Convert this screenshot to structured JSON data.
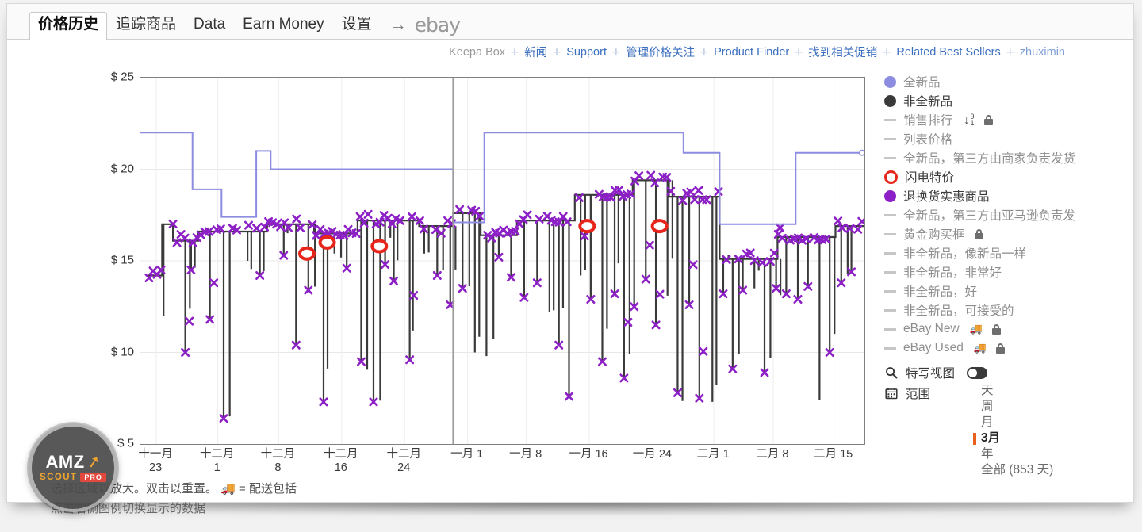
{
  "tabs": [
    {
      "label": "价格历史",
      "active": true
    },
    {
      "label": "追踪商品",
      "active": false
    },
    {
      "label": "Data",
      "active": false
    },
    {
      "label": "Earn Money",
      "active": false
    },
    {
      "label": "设置",
      "active": false
    }
  ],
  "header": {
    "arrow": "→",
    "ebay_logo": "ebay"
  },
  "navlinks": [
    {
      "label": "Keepa Box",
      "type": "static"
    },
    {
      "label": "新闻",
      "type": "link"
    },
    {
      "label": "Support",
      "type": "link"
    },
    {
      "label": "管理价格关注",
      "type": "link"
    },
    {
      "label": "Product Finder",
      "type": "link"
    },
    {
      "label": "找到相关促销",
      "type": "link"
    },
    {
      "label": "Related Best Sellers",
      "type": "link"
    },
    {
      "label": "zhuximin",
      "type": "muted"
    }
  ],
  "nav_separator": "✛",
  "legend": [
    {
      "label": "全新品",
      "marker": "dot",
      "color": "#8c8ce0",
      "active": false,
      "lock": false
    },
    {
      "label": "非全新品",
      "marker": "dot",
      "color": "#3a3a3a",
      "active": true,
      "lock": false
    },
    {
      "label": "销售排行",
      "marker": "dash",
      "color": "#c6c6c6",
      "active": false,
      "lock": true,
      "sort_icon": true,
      "sort_high": "9",
      "sort_low": "1"
    },
    {
      "label": "列表价格",
      "marker": "dash",
      "color": "#c6c6c6",
      "active": false,
      "lock": false
    },
    {
      "label": "全新品，第三方由商家负责发货",
      "marker": "dash",
      "color": "#c6c6c6",
      "active": false,
      "lock": false
    },
    {
      "label": "闪电特价",
      "marker": "ring",
      "color": "#e8251b",
      "active": true,
      "lock": false
    },
    {
      "label": "退换货实惠商品",
      "marker": "dot",
      "color": "#8c1fc6",
      "active": true,
      "lock": false
    },
    {
      "label": "全新品，第三方由亚马逊负责发",
      "marker": "dash",
      "color": "#c6c6c6",
      "active": false,
      "lock": false
    },
    {
      "label": "黄金购买框",
      "marker": "dash",
      "color": "#c6c6c6",
      "active": false,
      "lock": true
    },
    {
      "label": "非全新品，像新品一样",
      "marker": "dash",
      "color": "#c6c6c6",
      "active": false,
      "lock": false
    },
    {
      "label": "非全新品，非常好",
      "marker": "dash",
      "color": "#c6c6c6",
      "active": false,
      "lock": false
    },
    {
      "label": "非全新品，好",
      "marker": "dash",
      "color": "#c6c6c6",
      "active": false,
      "lock": false
    },
    {
      "label": "非全新品，可接受的",
      "marker": "dash",
      "color": "#c6c6c6",
      "active": false,
      "lock": false
    },
    {
      "label": "eBay New",
      "marker": "dash",
      "color": "#c6c6c6",
      "active": false,
      "lock": true,
      "truck": true
    },
    {
      "label": "eBay Used",
      "marker": "dash",
      "color": "#c6c6c6",
      "active": false,
      "lock": true,
      "truck": true
    }
  ],
  "controls": {
    "closeup_label": "特写视图",
    "closeup_on": false,
    "range_label": "范围",
    "range_options": [
      {
        "label": "天",
        "selected": false
      },
      {
        "label": "周",
        "selected": false
      },
      {
        "label": "月",
        "selected": false
      },
      {
        "label": "3月",
        "selected": true
      },
      {
        "label": "年",
        "selected": false
      },
      {
        "label": "全部 (853 天)",
        "selected": false
      }
    ]
  },
  "footer": {
    "line1": "选择区域以放大。双击以重置。",
    "truck": "🚚",
    "shipping_note": "= 配送包括",
    "line2": "点击右侧图例切换显示的数据"
  },
  "badge": {
    "amz": "AMZ",
    "scout": "SCOUT",
    "pro": "PRO"
  },
  "chart_data": {
    "type": "line",
    "title": "价格历史",
    "xlabel": "",
    "ylabel": "",
    "ylim": [
      5,
      25
    ],
    "yticks": [
      5,
      10,
      15,
      20,
      25
    ],
    "ytick_labels": [
      "$ 5",
      "$ 10",
      "$ 15",
      "$ 20",
      "$ 25"
    ],
    "grid": true,
    "legend_position": "right",
    "xtick_labels": [
      {
        "month": "十一月",
        "day": "23"
      },
      {
        "month": "十二月",
        "day": "1"
      },
      {
        "month": "十二月",
        "day": "8"
      },
      {
        "month": "十二月",
        "day": "16"
      },
      {
        "month": "十二月",
        "day": "24"
      },
      {
        "month": "一月 1",
        "day": ""
      },
      {
        "month": "一月 8",
        "day": ""
      },
      {
        "month": "一月 16",
        "day": ""
      },
      {
        "month": "一月 24",
        "day": ""
      },
      {
        "month": "二月 1",
        "day": ""
      },
      {
        "month": "二月 8",
        "day": ""
      },
      {
        "month": "二月 15",
        "day": ""
      }
    ],
    "xtick_positions": [
      0.022,
      0.107,
      0.191,
      0.278,
      0.365,
      0.452,
      0.533,
      0.62,
      0.708,
      0.792,
      0.874,
      0.958
    ],
    "cursor_x": 0.432,
    "series": [
      {
        "name": "列表价格",
        "type": "step",
        "color": "#8c8ce0",
        "points": [
          [
            0.0,
            22.0
          ],
          [
            0.072,
            22.0
          ],
          [
            0.072,
            18.9
          ],
          [
            0.112,
            18.9
          ],
          [
            0.112,
            17.4
          ],
          [
            0.16,
            17.4
          ],
          [
            0.16,
            21.0
          ],
          [
            0.18,
            21.0
          ],
          [
            0.18,
            20.0
          ],
          [
            0.432,
            20.0
          ],
          [
            0.432,
            17.1
          ],
          [
            0.475,
            17.1
          ],
          [
            0.475,
            22.0
          ],
          [
            0.75,
            22.0
          ],
          [
            0.75,
            20.9
          ],
          [
            0.8,
            20.9
          ],
          [
            0.8,
            17.0
          ],
          [
            0.905,
            17.0
          ],
          [
            0.905,
            20.9
          ],
          [
            1.0,
            20.9
          ]
        ]
      },
      {
        "name": "非全新品",
        "type": "spikes",
        "color": "#3a3a3a",
        "baseline_points": [
          [
            0.01,
            14.2
          ],
          [
            0.03,
            14.2
          ],
          [
            0.03,
            17.0
          ],
          [
            0.045,
            17.0
          ],
          [
            0.045,
            16.1
          ],
          [
            0.08,
            16.1
          ],
          [
            0.08,
            16.6
          ],
          [
            0.175,
            16.6
          ],
          [
            0.175,
            17.0
          ],
          [
            0.24,
            17.0
          ],
          [
            0.24,
            16.5
          ],
          [
            0.3,
            16.5
          ],
          [
            0.3,
            17.2
          ],
          [
            0.385,
            17.2
          ],
          [
            0.385,
            16.9
          ],
          [
            0.432,
            16.9
          ],
          [
            0.432,
            17.6
          ],
          [
            0.47,
            17.6
          ],
          [
            0.47,
            16.4
          ],
          [
            0.52,
            16.4
          ],
          [
            0.52,
            17.2
          ],
          [
            0.6,
            17.2
          ],
          [
            0.6,
            18.6
          ],
          [
            0.68,
            18.6
          ],
          [
            0.68,
            19.4
          ],
          [
            0.73,
            19.4
          ],
          [
            0.73,
            18.5
          ],
          [
            0.8,
            18.5
          ],
          [
            0.8,
            15.1
          ],
          [
            0.88,
            15.1
          ],
          [
            0.88,
            16.3
          ],
          [
            0.96,
            16.3
          ],
          [
            0.96,
            16.9
          ],
          [
            1.0,
            16.9
          ]
        ],
        "spike_lows": [
          [
            0.032,
            12.0
          ],
          [
            0.062,
            10.0
          ],
          [
            0.07,
            14.5
          ],
          [
            0.096,
            11.8
          ],
          [
            0.115,
            6.4
          ],
          [
            0.148,
            15.0
          ],
          [
            0.165,
            14.2
          ],
          [
            0.198,
            15.3
          ],
          [
            0.215,
            10.4
          ],
          [
            0.232,
            13.4
          ],
          [
            0.253,
            7.3
          ],
          [
            0.268,
            15.4
          ],
          [
            0.285,
            14.6
          ],
          [
            0.305,
            9.5
          ],
          [
            0.322,
            7.3
          ],
          [
            0.338,
            14.8
          ],
          [
            0.35,
            13.9
          ],
          [
            0.372,
            9.6
          ],
          [
            0.392,
            15.4
          ],
          [
            0.41,
            14.2
          ],
          [
            0.428,
            12.6
          ],
          [
            0.445,
            13.5
          ],
          [
            0.462,
            10.0
          ],
          [
            0.478,
            9.8
          ],
          [
            0.495,
            15.2
          ],
          [
            0.512,
            14.1
          ],
          [
            0.53,
            13.0
          ],
          [
            0.548,
            13.8
          ],
          [
            0.565,
            12.2
          ],
          [
            0.578,
            10.4
          ],
          [
            0.592,
            7.6
          ],
          [
            0.608,
            14.2
          ],
          [
            0.622,
            12.9
          ],
          [
            0.638,
            9.5
          ],
          [
            0.655,
            13.2
          ],
          [
            0.668,
            8.6
          ],
          [
            0.682,
            12.5
          ],
          [
            0.698,
            14.0
          ],
          [
            0.712,
            11.5
          ],
          [
            0.728,
            13.1
          ],
          [
            0.742,
            7.8
          ],
          [
            0.758,
            12.6
          ],
          [
            0.772,
            7.5
          ],
          [
            0.79,
            7.3
          ],
          [
            0.805,
            13.2
          ],
          [
            0.818,
            9.1
          ],
          [
            0.832,
            13.4
          ],
          [
            0.848,
            13.5
          ],
          [
            0.862,
            8.9
          ],
          [
            0.878,
            13.5
          ],
          [
            0.892,
            13.2
          ],
          [
            0.908,
            12.9
          ],
          [
            0.922,
            13.6
          ],
          [
            0.938,
            7.4
          ],
          [
            0.952,
            10.0
          ],
          [
            0.968,
            13.8
          ],
          [
            0.982,
            14.4
          ]
        ]
      },
      {
        "name": "退换货实惠商品",
        "type": "markers",
        "marker": "x",
        "color": "#8c1fc6",
        "note": "Dense purple X markers along the used-price envelope between $7 and $19"
      },
      {
        "name": "闪电特价",
        "type": "markers",
        "marker": "ring",
        "color": "#e8251b",
        "points": [
          [
            0.23,
            15.4
          ],
          [
            0.258,
            16.0
          ],
          [
            0.33,
            15.8
          ],
          [
            0.617,
            16.9
          ],
          [
            0.717,
            16.9
          ]
        ]
      }
    ]
  }
}
